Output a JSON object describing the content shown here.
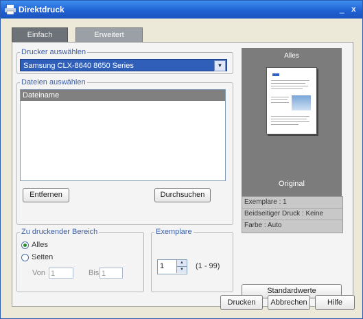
{
  "window": {
    "title": "Direktdruck",
    "minimize": "_",
    "close": "x"
  },
  "tabs": [
    {
      "label": "Einfach"
    },
    {
      "label": "Erweitert"
    }
  ],
  "printer": {
    "legend": "Drucker auswählen",
    "selected": "Samsung CLX-8640 8650 Series"
  },
  "files": {
    "legend": "Dateien auswählen",
    "column": "Dateiname",
    "remove_label": "Entfernen",
    "browse_label": "Durchsuchen"
  },
  "range": {
    "legend": "Zu druckender Bereich",
    "all_label": "Alles",
    "pages_label": "Seiten",
    "from_label": "Von",
    "from_value": "1",
    "to_label": "Bis",
    "to_value": "1"
  },
  "copies": {
    "legend": "Exemplare",
    "value": "1",
    "range": "(1 - 99)"
  },
  "preview": {
    "title": "Alles",
    "caption": "Original"
  },
  "info": {
    "copies": "Exemplare : 1",
    "duplex": "Beidseitiger Druck : Keine",
    "color": "Farbe : Auto"
  },
  "buttons": {
    "defaults": "Standardwerte",
    "print": "Drucken",
    "cancel": "Abbrechen",
    "help": "Hilfe"
  },
  "colors": {
    "titlebar": "#1e5fd0",
    "selection": "#2f5fb8"
  }
}
